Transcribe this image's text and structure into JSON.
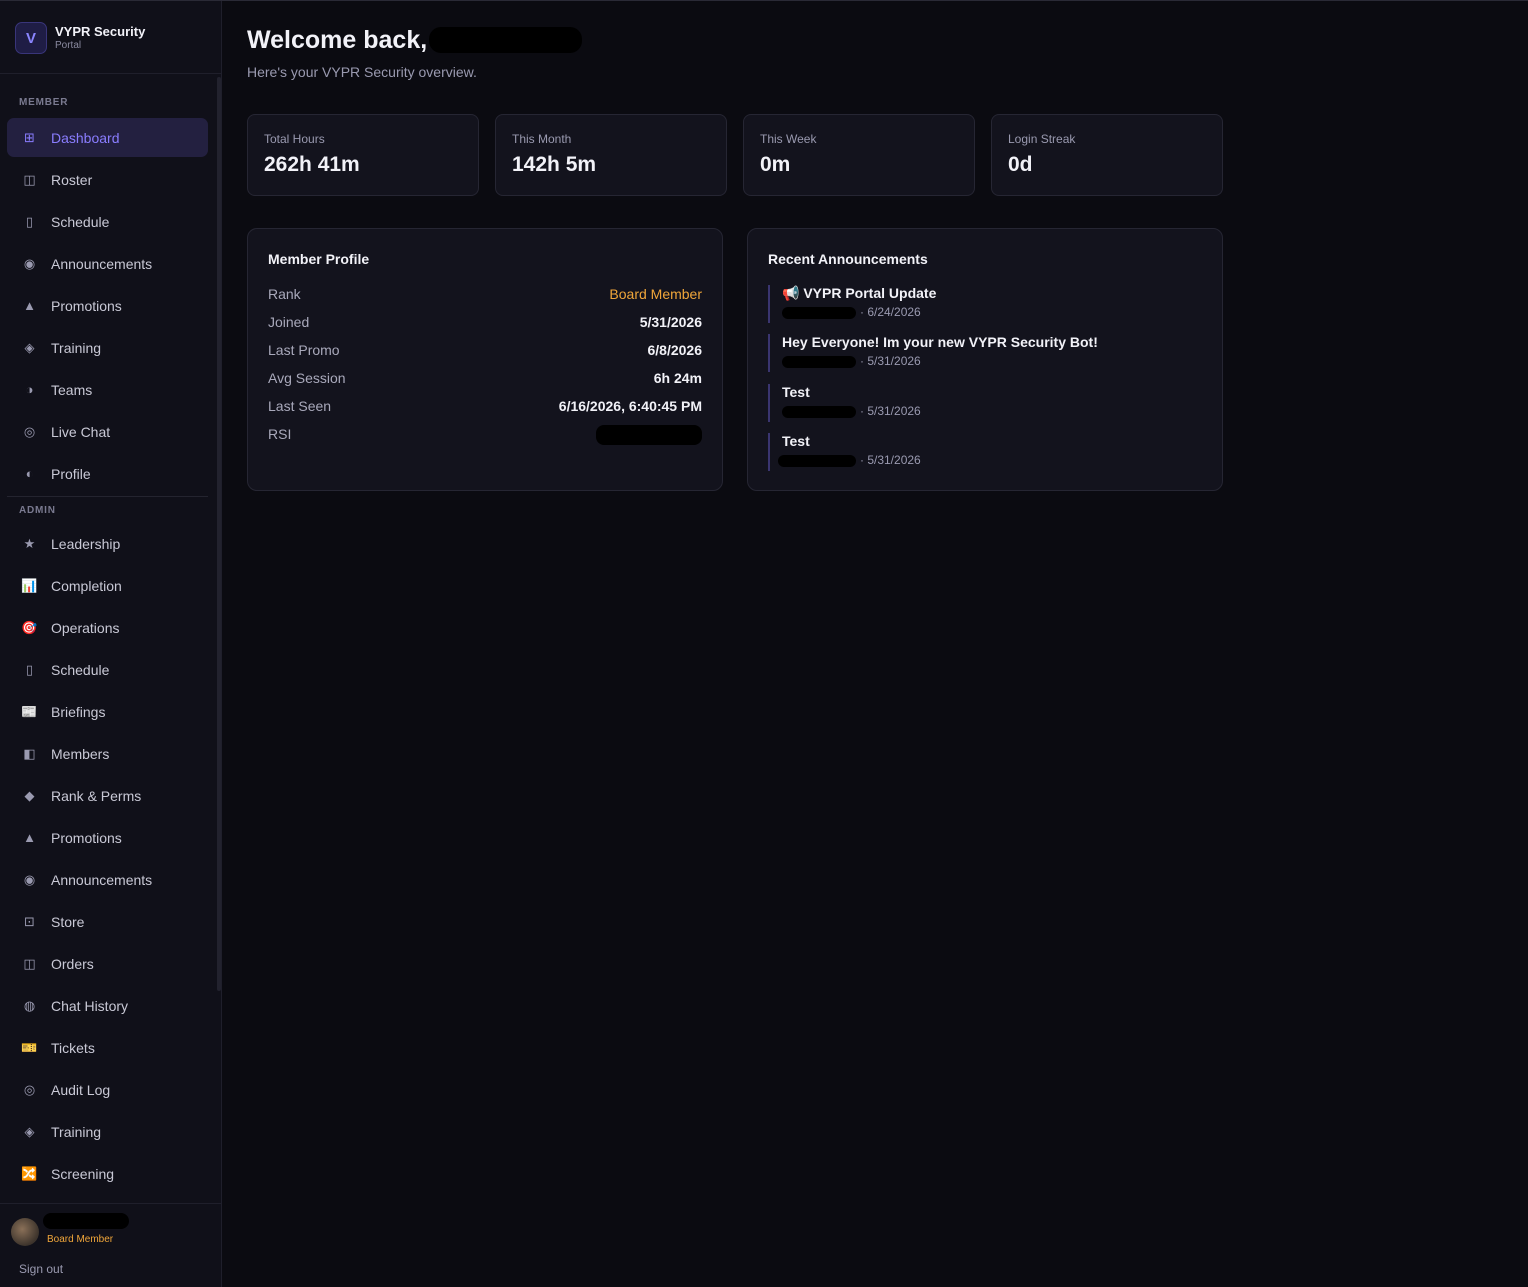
{
  "brand": {
    "logo_letter": "V",
    "title": "VYPR Security",
    "subtitle": "Portal"
  },
  "sidebar": {
    "member_label": "MEMBER",
    "admin_label": "ADMIN",
    "member_items": [
      {
        "label": "Dashboard",
        "icon": "grid-icon",
        "glyph": "⊞",
        "active": true
      },
      {
        "label": "Roster",
        "icon": "columns-icon",
        "glyph": "◫",
        "active": false
      },
      {
        "label": "Schedule",
        "icon": "calendar-icon",
        "glyph": "▯",
        "active": false
      },
      {
        "label": "Announcements",
        "icon": "dot-circle-icon",
        "glyph": "◉",
        "active": false
      },
      {
        "label": "Promotions",
        "icon": "triangle-icon",
        "glyph": "▲",
        "active": false
      },
      {
        "label": "Training",
        "icon": "diamond-icon",
        "glyph": "◈",
        "active": false
      },
      {
        "label": "Teams",
        "icon": "half-circle-icon",
        "glyph": "◑",
        "active": false
      },
      {
        "label": "Live Chat",
        "icon": "ring-icon",
        "glyph": "◎",
        "active": false
      },
      {
        "label": "Profile",
        "icon": "profile-icon",
        "glyph": "◐",
        "active": false
      }
    ],
    "admin_items": [
      {
        "label": "Leadership",
        "icon": "star-icon",
        "glyph": "★"
      },
      {
        "label": "Completion",
        "icon": "bar-chart-icon",
        "glyph": "📊"
      },
      {
        "label": "Operations",
        "icon": "target-icon",
        "glyph": "🎯"
      },
      {
        "label": "Schedule",
        "icon": "calendar-icon",
        "glyph": "▯"
      },
      {
        "label": "Briefings",
        "icon": "newspaper-icon",
        "glyph": "📰"
      },
      {
        "label": "Members",
        "icon": "members-icon",
        "glyph": "◧"
      },
      {
        "label": "Rank & Perms",
        "icon": "diamond-icon",
        "glyph": "◆"
      },
      {
        "label": "Promotions",
        "icon": "triangle-icon",
        "glyph": "▲"
      },
      {
        "label": "Announcements",
        "icon": "dot-circle-icon",
        "glyph": "◉"
      },
      {
        "label": "Store",
        "icon": "store-icon",
        "glyph": "⊡"
      },
      {
        "label": "Orders",
        "icon": "columns-icon",
        "glyph": "◫"
      },
      {
        "label": "Chat History",
        "icon": "chat-history-icon",
        "glyph": "◍"
      },
      {
        "label": "Tickets",
        "icon": "ticket-icon",
        "glyph": "🎫"
      },
      {
        "label": "Audit Log",
        "icon": "ring-icon",
        "glyph": "◎"
      },
      {
        "label": "Training",
        "icon": "diamond-icon",
        "glyph": "◈"
      },
      {
        "label": "Screening",
        "icon": "screening-icon",
        "glyph": "🔀"
      }
    ]
  },
  "user": {
    "rank": "Board Member",
    "signout": "Sign out"
  },
  "header": {
    "welcome": "Welcome back,",
    "subtitle": "Here's your VYPR Security overview."
  },
  "stats": [
    {
      "label": "Total Hours",
      "value": "262h 41m"
    },
    {
      "label": "This Month",
      "value": "142h 5m"
    },
    {
      "label": "This Week",
      "value": "0m"
    },
    {
      "label": "Login Streak",
      "value": "0d"
    }
  ],
  "profile": {
    "title": "Member Profile",
    "rows": [
      {
        "key": "Rank",
        "value": "Board Member"
      },
      {
        "key": "Joined",
        "value": "5/31/2026"
      },
      {
        "key": "Last Promo",
        "value": "6/8/2026"
      },
      {
        "key": "Avg Session",
        "value": "6h 24m"
      },
      {
        "key": "Last Seen",
        "value": "6/16/2026, 6:40:45 PM"
      },
      {
        "key": "RSI",
        "value": ""
      }
    ]
  },
  "announcements": {
    "title": "Recent Announcements",
    "items": [
      {
        "title": "📢 VYPR Portal Update",
        "date": "· 6/24/2026"
      },
      {
        "title": "Hey Everyone! Im your new VYPR Security Bot!",
        "date": "· 5/31/2026"
      },
      {
        "title": "Test",
        "date": "· 5/31/2026"
      },
      {
        "title": "Test",
        "date": "· 5/31/2026"
      }
    ]
  },
  "colors": {
    "accent": "#8a7dff",
    "rank": "#f0a63a",
    "background": "#0b0b11",
    "card": "#13131d"
  }
}
